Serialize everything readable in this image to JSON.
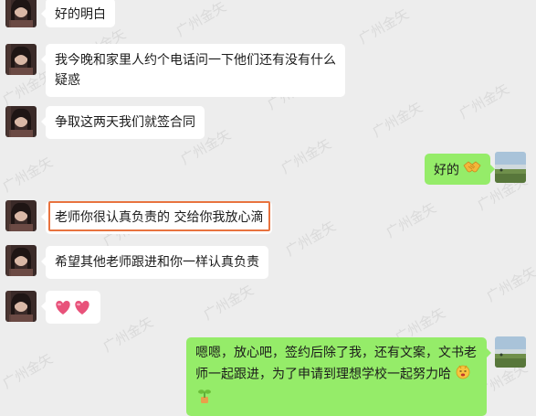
{
  "watermark": "广州金矢",
  "colors": {
    "background": "#ededed",
    "incoming_bubble": "#ffffff",
    "outgoing_bubble": "#95ec69",
    "highlight": "#e8733f"
  },
  "messages": [
    {
      "side": "left",
      "text": "好的明白"
    },
    {
      "side": "left",
      "line1": "我今晚和家里人约个电话问一下他们还有没有什么",
      "line2": "疑惑"
    },
    {
      "side": "left",
      "text": "争取这两天我们就签合同"
    },
    {
      "side": "right",
      "text": "好的",
      "emoji": "handshake-emoji"
    },
    {
      "side": "left",
      "text": "老师你很认真负责的 交给你我放心滴",
      "highlighted": true
    },
    {
      "side": "left",
      "text": "希望其他老师跟进和你一样认真负责"
    },
    {
      "side": "left",
      "emoji": "two-hearts-emoji"
    },
    {
      "side": "right",
      "line1": "嗯嗯，放心吧，签约后除了我，还有文案，文书老",
      "line2": "师一起跟进，为了申请到理想学校一起努力哈",
      "emoji1": "cheering-face-emoji",
      "emoji2": "seedling-emoji"
    }
  ]
}
